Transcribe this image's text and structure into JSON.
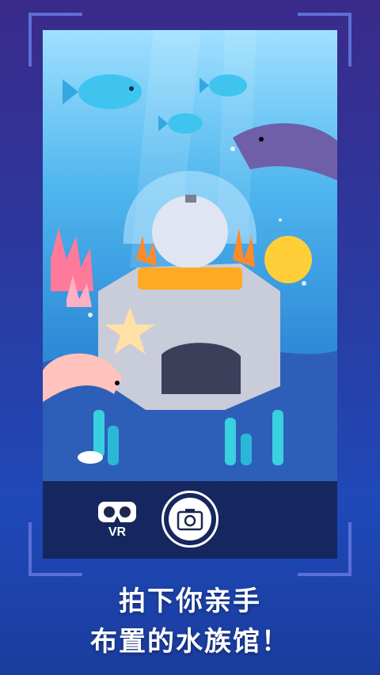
{
  "toolbar": {
    "vr_label": "VR",
    "vr_icon": "vr-headset-icon",
    "camera_icon": "camera-icon"
  },
  "caption": {
    "line1": "拍下你亲手",
    "line2": "布置的水族馆！"
  },
  "colors": {
    "frame": "#5b6fd8",
    "accent_white": "#ffffff",
    "coral_orange": "#ff8a2a",
    "dolphin_purple": "#6f5fa8"
  }
}
